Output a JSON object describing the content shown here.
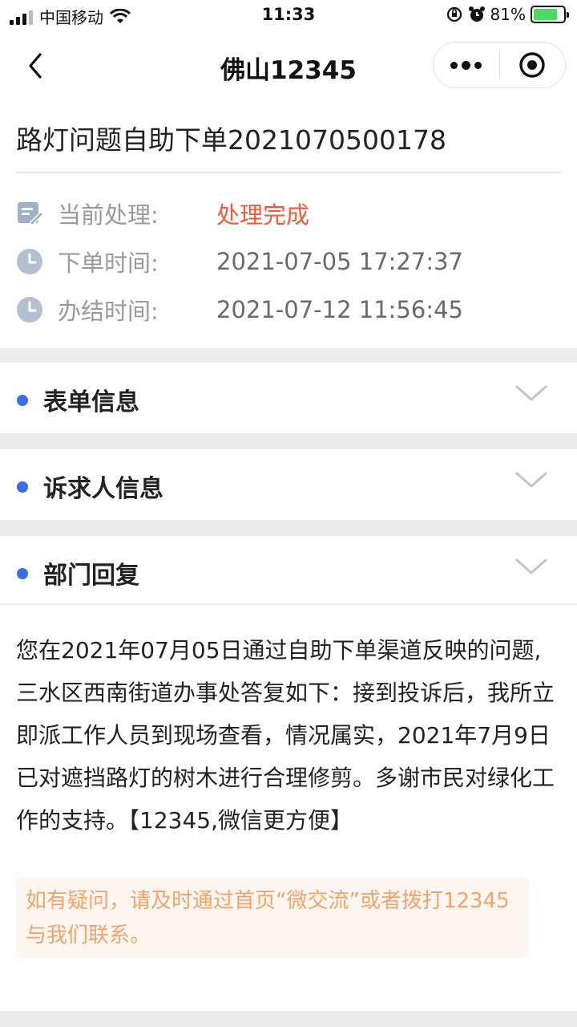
{
  "status_bar": {
    "carrier": "中国移动",
    "time": "11:33",
    "battery_percent": "81%",
    "battery_level": 0.81,
    "battery_color": "#4cd964"
  },
  "nav": {
    "title": "佛山12345",
    "back_icon": "chevron-left-icon",
    "more_icon": "more-dots-icon",
    "close_icon": "target-circle-icon"
  },
  "order": {
    "title": "路灯问题自助下单2021070500178",
    "rows": [
      {
        "icon": "edit-note-icon",
        "label": "当前处理:",
        "value": "处理完成",
        "value_color": "#f15a3a"
      },
      {
        "icon": "clock-icon",
        "label": "下单时间:",
        "value": "2021-07-05 17:27:37"
      },
      {
        "icon": "clock-icon",
        "label": "办结时间:",
        "value": "2021-07-12 11:56:45"
      }
    ]
  },
  "sections": [
    {
      "label": "表单信息",
      "icon": "chevron-down-icon"
    },
    {
      "label": "诉求人信息",
      "icon": "chevron-down-icon"
    },
    {
      "label": "部门回复",
      "icon": "chevron-down-icon"
    }
  ],
  "reply": {
    "text": "您在2021年07月05日通过自助下单渠道反映的问题,三水区西南街道办事处答复如下：接到投诉后，我所立即派工作人员到现场查看，情况属实，2021年7月9日已对遮挡路灯的树木进行合理修剪。多谢市民对绿化工作的支持。【12345,微信更方便】",
    "notice": "如有疑问，请及时通过首页“微交流”或者拨打12345与我们联系。"
  },
  "colors": {
    "accent_dot": "#3b6fe0",
    "status_done": "#f15a3a",
    "notice_text": "#f2a46d",
    "notice_bg": "#fdf6f0",
    "separator": "#ededf0"
  }
}
